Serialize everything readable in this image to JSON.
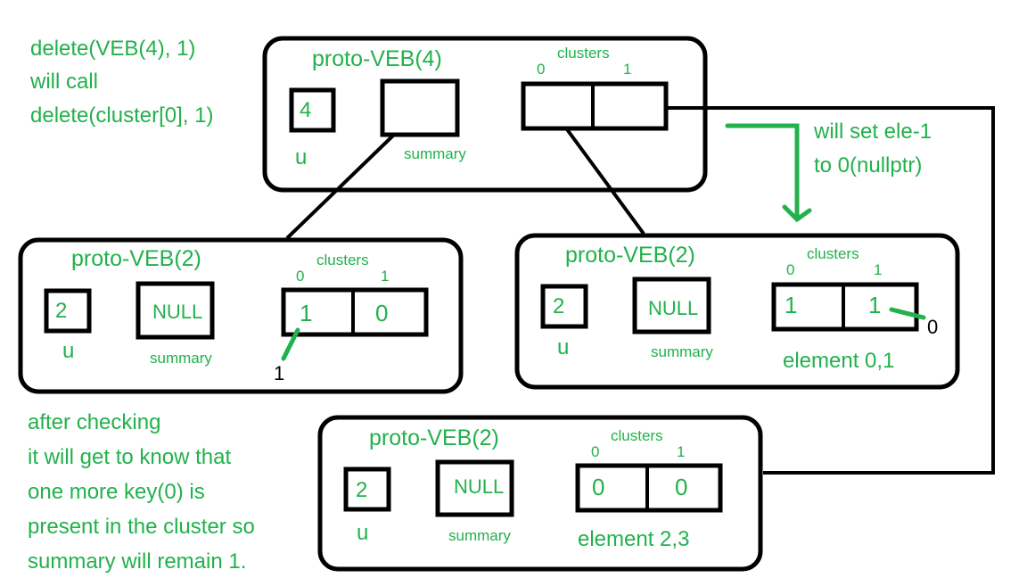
{
  "colors": {
    "text": "#22b14c",
    "lines": "#000000",
    "annotation": "#22b14c"
  },
  "notes": {
    "top_left": [
      "delete(VEB(4), 1)",
      "will call",
      "delete(cluster[0], 1)"
    ],
    "arrow_note": [
      "will set ele-1",
      "to 0(nullptr)"
    ],
    "bottom_left": [
      "after checking",
      "it will get to know that",
      "one more key(0) is",
      "present in the cluster so",
      "summary will remain 1."
    ]
  },
  "nodes": {
    "root": {
      "title": "proto-VEB(4)",
      "u_value": "4",
      "u_label": "u",
      "summary_value": "",
      "summary_label": "summary",
      "clusters_label": "clusters",
      "cluster_indices": [
        "0",
        "1"
      ],
      "cluster_values": [
        "",
        ""
      ]
    },
    "left": {
      "title": "proto-VEB(2)",
      "u_value": "2",
      "u_label": "u",
      "summary_value": "NULL",
      "summary_label": "summary",
      "clusters_label": "clusters",
      "cluster_indices": [
        "0",
        "1"
      ],
      "cluster_values": [
        "1",
        "0"
      ],
      "annotation": "1"
    },
    "right": {
      "title": "proto-VEB(2)",
      "u_value": "2",
      "u_label": "u",
      "summary_value": "NULL",
      "summary_label": "summary",
      "clusters_label": "clusters",
      "cluster_indices": [
        "0",
        "1"
      ],
      "cluster_values": [
        "1",
        "1"
      ],
      "annotation": "0",
      "caption": "element 0,1"
    },
    "bottom": {
      "title": "proto-VEB(2)",
      "u_value": "2",
      "u_label": "u",
      "summary_value": "NULL",
      "summary_label": "summary",
      "clusters_label": "clusters",
      "cluster_indices": [
        "0",
        "1"
      ],
      "cluster_values": [
        "0",
        "0"
      ],
      "caption": "element 2,3"
    }
  }
}
